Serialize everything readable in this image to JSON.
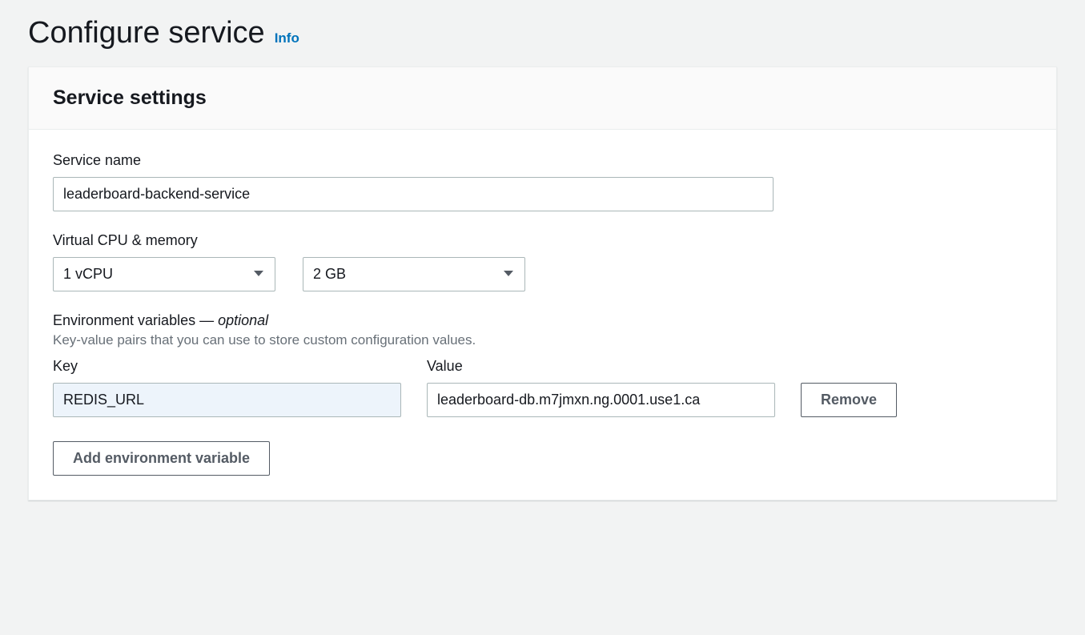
{
  "page": {
    "title": "Configure service",
    "info_link": "Info"
  },
  "panel": {
    "title": "Service settings"
  },
  "service_name": {
    "label": "Service name",
    "value": "leaderboard-backend-service"
  },
  "cpu_memory": {
    "label": "Virtual CPU & memory",
    "cpu_value": "1 vCPU",
    "memory_value": "2 GB"
  },
  "env": {
    "label_main": "Environment variables — ",
    "label_optional": "optional",
    "description": "Key-value pairs that you can use to store custom configuration values.",
    "key_header": "Key",
    "value_header": "Value",
    "rows": [
      {
        "key": "REDIS_URL",
        "value": "leaderboard-db.m7jmxn.ng.0001.use1.ca"
      }
    ],
    "remove_label": "Remove",
    "add_label": "Add environment variable"
  }
}
